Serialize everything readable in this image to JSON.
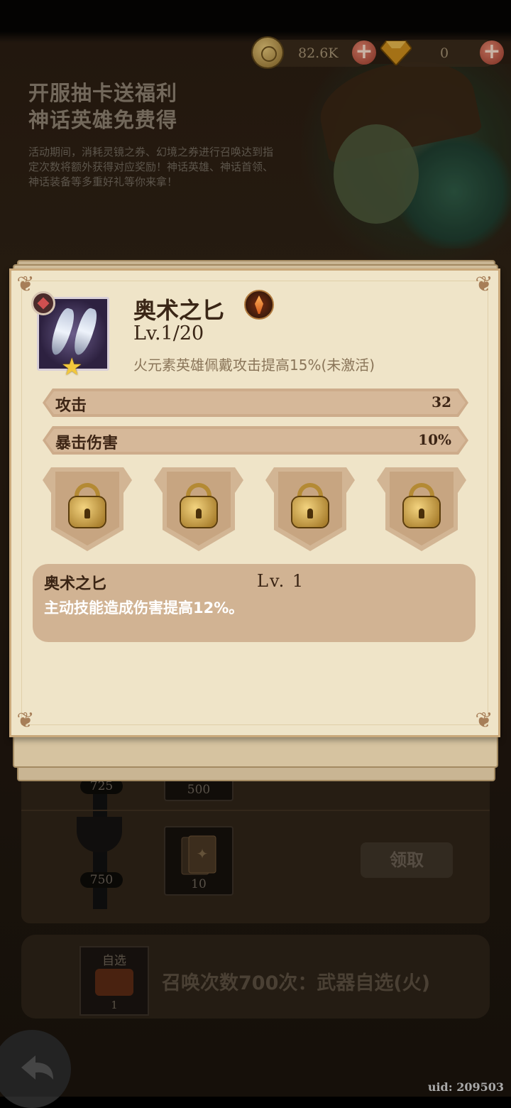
{
  "resources": {
    "coins": "82.6K",
    "gems": "0"
  },
  "promo": {
    "title_line1": "开服抽卡送福利",
    "title_line2": "神话英雄免费得",
    "description": "活动期间，消耗灵镜之券、幻境之券进行召唤达到指定次数将额外获得对应奖励！神话英雄、神话首领、神话装备等多重好礼等你来拿！"
  },
  "milestones": [
    {
      "threshold": "725",
      "reward_count": "500"
    },
    {
      "threshold": "750",
      "reward_count": "10",
      "claim_label": "领取"
    }
  ],
  "bottom_reward": {
    "card_label": "自选",
    "card_count": "1",
    "text": "召唤次数700次：武器自选(火)"
  },
  "uid": "uid: 209503",
  "item": {
    "name": "奥术之匕",
    "level": "Lv.1/20",
    "effect": "火元素英雄佩戴攻击提高15%(未激活)",
    "stats": [
      {
        "label": "攻击",
        "value": "32"
      },
      {
        "label": "暴击伤害",
        "value": "10%"
      }
    ],
    "skill": {
      "name": "奥术之匕",
      "level": "Lv. 1",
      "description": "主动技能造成伤害提高12%。"
    }
  }
}
